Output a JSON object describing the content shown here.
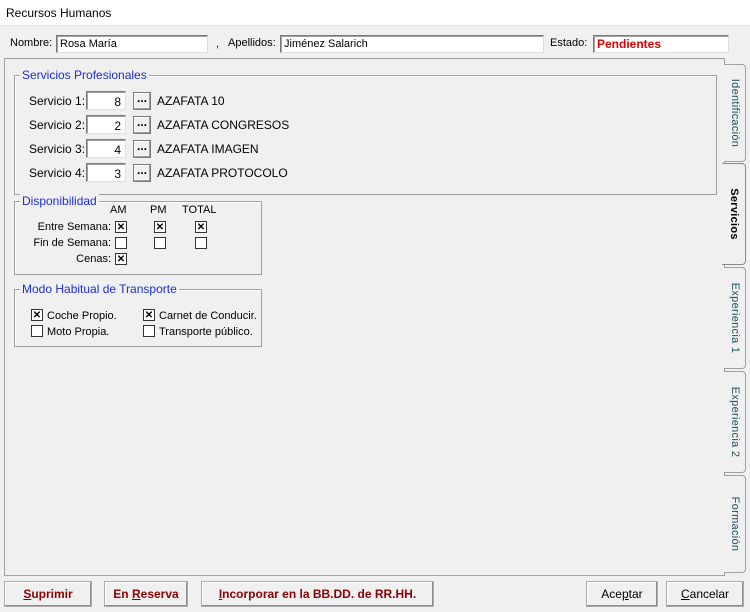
{
  "window": {
    "title": "Recursos Humanos"
  },
  "header": {
    "nombre_label": "Nombre:",
    "nombre_value": "Rosa María",
    "apellidos_label": "Apellidos:",
    "apellidos_value": "Jiménez Salarich",
    "separator": ",",
    "estado_label": "Estado:",
    "estado_value": "Pendientes"
  },
  "servicios": {
    "title": "Servicios Profesionales",
    "rows": [
      {
        "label": "Servicio 1:",
        "code": "8",
        "name": "AZAFATA 10"
      },
      {
        "label": "Servicio 2:",
        "code": "2",
        "name": "AZAFATA CONGRESOS"
      },
      {
        "label": "Servicio 3:",
        "code": "4",
        "name": "AZAFATA IMAGEN"
      },
      {
        "label": "Servicio 4:",
        "code": "3",
        "name": "AZAFATA PROTOCOLO"
      }
    ],
    "lookup_label": "..."
  },
  "disponibilidad": {
    "title": "Disponibilidad",
    "col_am": "AM",
    "col_pm": "PM",
    "col_total": "TOTAL",
    "row_semana": "Entre Semana:",
    "row_finde": "Fin de Semana:",
    "row_cenas": "Cenas:",
    "semana": {
      "am": true,
      "pm": true,
      "total": true
    },
    "finde": {
      "am": false,
      "pm": false,
      "total": false
    },
    "cenas": {
      "am": true
    }
  },
  "transporte": {
    "title": "Modo Habitual de Transporte",
    "coche": {
      "label": "Coche Propio.",
      "checked": true
    },
    "carnet": {
      "label": "Carnet de Conducir.",
      "checked": true
    },
    "moto": {
      "label": "Moto Propia.",
      "checked": false
    },
    "publico": {
      "label": "Transporte público.",
      "checked": false
    }
  },
  "tabs": [
    {
      "label": "Identificación",
      "active": false
    },
    {
      "label": "Servicios",
      "active": true
    },
    {
      "label": "Experiencia 1",
      "active": false
    },
    {
      "label": "Experiencia 2",
      "active": false
    },
    {
      "label": "Formación",
      "active": false
    }
  ],
  "buttons": {
    "suprimir_u": "S",
    "suprimir_rest": "uprimir",
    "reserva_pre": "En ",
    "reserva_u": "R",
    "reserva_rest": "eserva",
    "incorporar_u": "I",
    "incorporar_rest": "ncorporar en la BB.DD. de RR.HH.",
    "aceptar_pre": "Ace",
    "aceptar_u": "p",
    "aceptar_rest": "tar",
    "cancelar_u": "C",
    "cancelar_rest": "ancelar"
  }
}
